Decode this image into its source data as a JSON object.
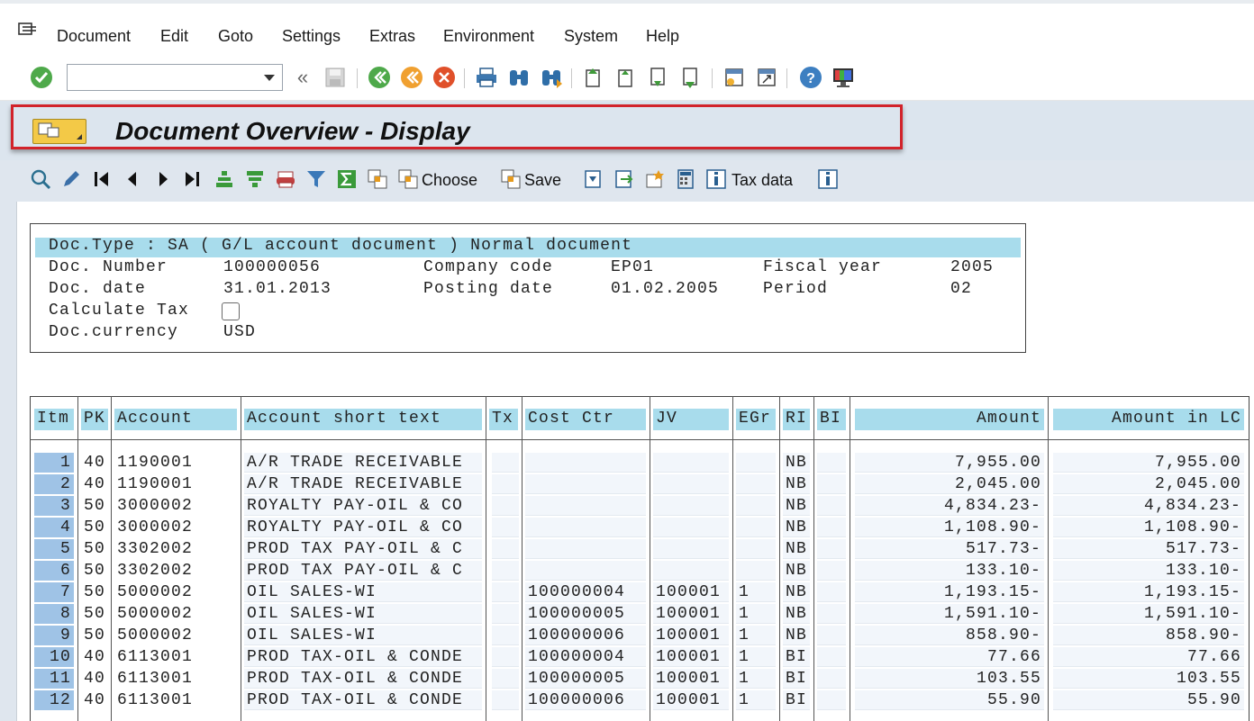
{
  "menu": {
    "items": [
      "Document",
      "Edit",
      "Goto",
      "Settings",
      "Extras",
      "Environment",
      "System",
      "Help"
    ]
  },
  "toolbar": {
    "command_value": "",
    "icons": [
      "enter-icon",
      "back-arrows-icon",
      "save-icon",
      "back-icon",
      "exit-icon",
      "cancel-icon",
      "print-icon",
      "find-icon",
      "find-next-icon",
      "first-page-icon",
      "previous-page-icon",
      "next-page-icon",
      "last-page-icon",
      "create-session-icon",
      "shortcut-icon",
      "help-icon",
      "layout-icon"
    ]
  },
  "title": "Document Overview - Display",
  "app_toolbar": {
    "choose_label": "Choose",
    "save_label": "Save",
    "tax_data_label": "Tax data"
  },
  "header": {
    "doc_type_line": "Doc.Type : SA ( G/L account document ) Normal document",
    "doc_number_label": "Doc. Number",
    "doc_number": "100000056",
    "company_code_label": "Company code",
    "company_code": "EP01",
    "fiscal_year_label": "Fiscal year",
    "fiscal_year": "2005",
    "doc_date_label": "Doc. date",
    "doc_date": "31.01.2013",
    "posting_date_label": "Posting date",
    "posting_date": "01.02.2005",
    "period_label": "Period",
    "period": "02",
    "calc_tax_label": "Calculate Tax",
    "calc_tax_checked": false,
    "currency_label": "Doc.currency",
    "currency": "USD"
  },
  "table": {
    "columns": [
      "Itm",
      "PK",
      "Account",
      "Account short text",
      "Tx",
      "Cost Ctr",
      "JV",
      "EGr",
      "RI",
      "BI",
      "Amount",
      "Amount in LC"
    ],
    "rows": [
      {
        "itm": "1",
        "pk": "40",
        "account": "1190001",
        "text": "A/R TRADE RECEIVABLE",
        "tx": "",
        "cost_ctr": "",
        "jv": "",
        "egr": "",
        "ri": "NB",
        "bi": "",
        "amount": "7,955.00",
        "amount_lc": "7,955.00"
      },
      {
        "itm": "2",
        "pk": "40",
        "account": "1190001",
        "text": "A/R TRADE RECEIVABLE",
        "tx": "",
        "cost_ctr": "",
        "jv": "",
        "egr": "",
        "ri": "NB",
        "bi": "",
        "amount": "2,045.00",
        "amount_lc": "2,045.00"
      },
      {
        "itm": "3",
        "pk": "50",
        "account": "3000002",
        "text": "ROYALTY PAY-OIL & CO",
        "tx": "",
        "cost_ctr": "",
        "jv": "",
        "egr": "",
        "ri": "NB",
        "bi": "",
        "amount": "4,834.23-",
        "amount_lc": "4,834.23-"
      },
      {
        "itm": "4",
        "pk": "50",
        "account": "3000002",
        "text": "ROYALTY PAY-OIL & CO",
        "tx": "",
        "cost_ctr": "",
        "jv": "",
        "egr": "",
        "ri": "NB",
        "bi": "",
        "amount": "1,108.90-",
        "amount_lc": "1,108.90-"
      },
      {
        "itm": "5",
        "pk": "50",
        "account": "3302002",
        "text": "PROD TAX PAY-OIL & C",
        "tx": "",
        "cost_ctr": "",
        "jv": "",
        "egr": "",
        "ri": "NB",
        "bi": "",
        "amount": "517.73-",
        "amount_lc": "517.73-"
      },
      {
        "itm": "6",
        "pk": "50",
        "account": "3302002",
        "text": "PROD TAX PAY-OIL & C",
        "tx": "",
        "cost_ctr": "",
        "jv": "",
        "egr": "",
        "ri": "NB",
        "bi": "",
        "amount": "133.10-",
        "amount_lc": "133.10-"
      },
      {
        "itm": "7",
        "pk": "50",
        "account": "5000002",
        "text": "OIL SALES-WI",
        "tx": "",
        "cost_ctr": "100000004",
        "jv": "100001",
        "egr": "1",
        "ri": "NB",
        "bi": "",
        "amount": "1,193.15-",
        "amount_lc": "1,193.15-"
      },
      {
        "itm": "8",
        "pk": "50",
        "account": "5000002",
        "text": "OIL SALES-WI",
        "tx": "",
        "cost_ctr": "100000005",
        "jv": "100001",
        "egr": "1",
        "ri": "NB",
        "bi": "",
        "amount": "1,591.10-",
        "amount_lc": "1,591.10-"
      },
      {
        "itm": "9",
        "pk": "50",
        "account": "5000002",
        "text": "OIL SALES-WI",
        "tx": "",
        "cost_ctr": "100000006",
        "jv": "100001",
        "egr": "1",
        "ri": "NB",
        "bi": "",
        "amount": "858.90-",
        "amount_lc": "858.90-"
      },
      {
        "itm": "10",
        "pk": "40",
        "account": "6113001",
        "text": "PROD TAX-OIL & CONDE",
        "tx": "",
        "cost_ctr": "100000004",
        "jv": "100001",
        "egr": "1",
        "ri": "BI",
        "bi": "",
        "amount": "77.66",
        "amount_lc": "77.66"
      },
      {
        "itm": "11",
        "pk": "40",
        "account": "6113001",
        "text": "PROD TAX-OIL & CONDE",
        "tx": "",
        "cost_ctr": "100000005",
        "jv": "100001",
        "egr": "1",
        "ri": "BI",
        "bi": "",
        "amount": "103.55",
        "amount_lc": "103.55"
      },
      {
        "itm": "12",
        "pk": "40",
        "account": "6113001",
        "text": "PROD TAX-OIL & CONDE",
        "tx": "",
        "cost_ctr": "100000006",
        "jv": "100001",
        "egr": "1",
        "ri": "BI",
        "bi": "",
        "amount": "55.90",
        "amount_lc": "55.90"
      }
    ]
  },
  "colors": {
    "header_band": "#a8dcec",
    "item_cell": "#9fc3e6",
    "highlight_border": "#d2232a",
    "title_button": "#f3c947"
  }
}
